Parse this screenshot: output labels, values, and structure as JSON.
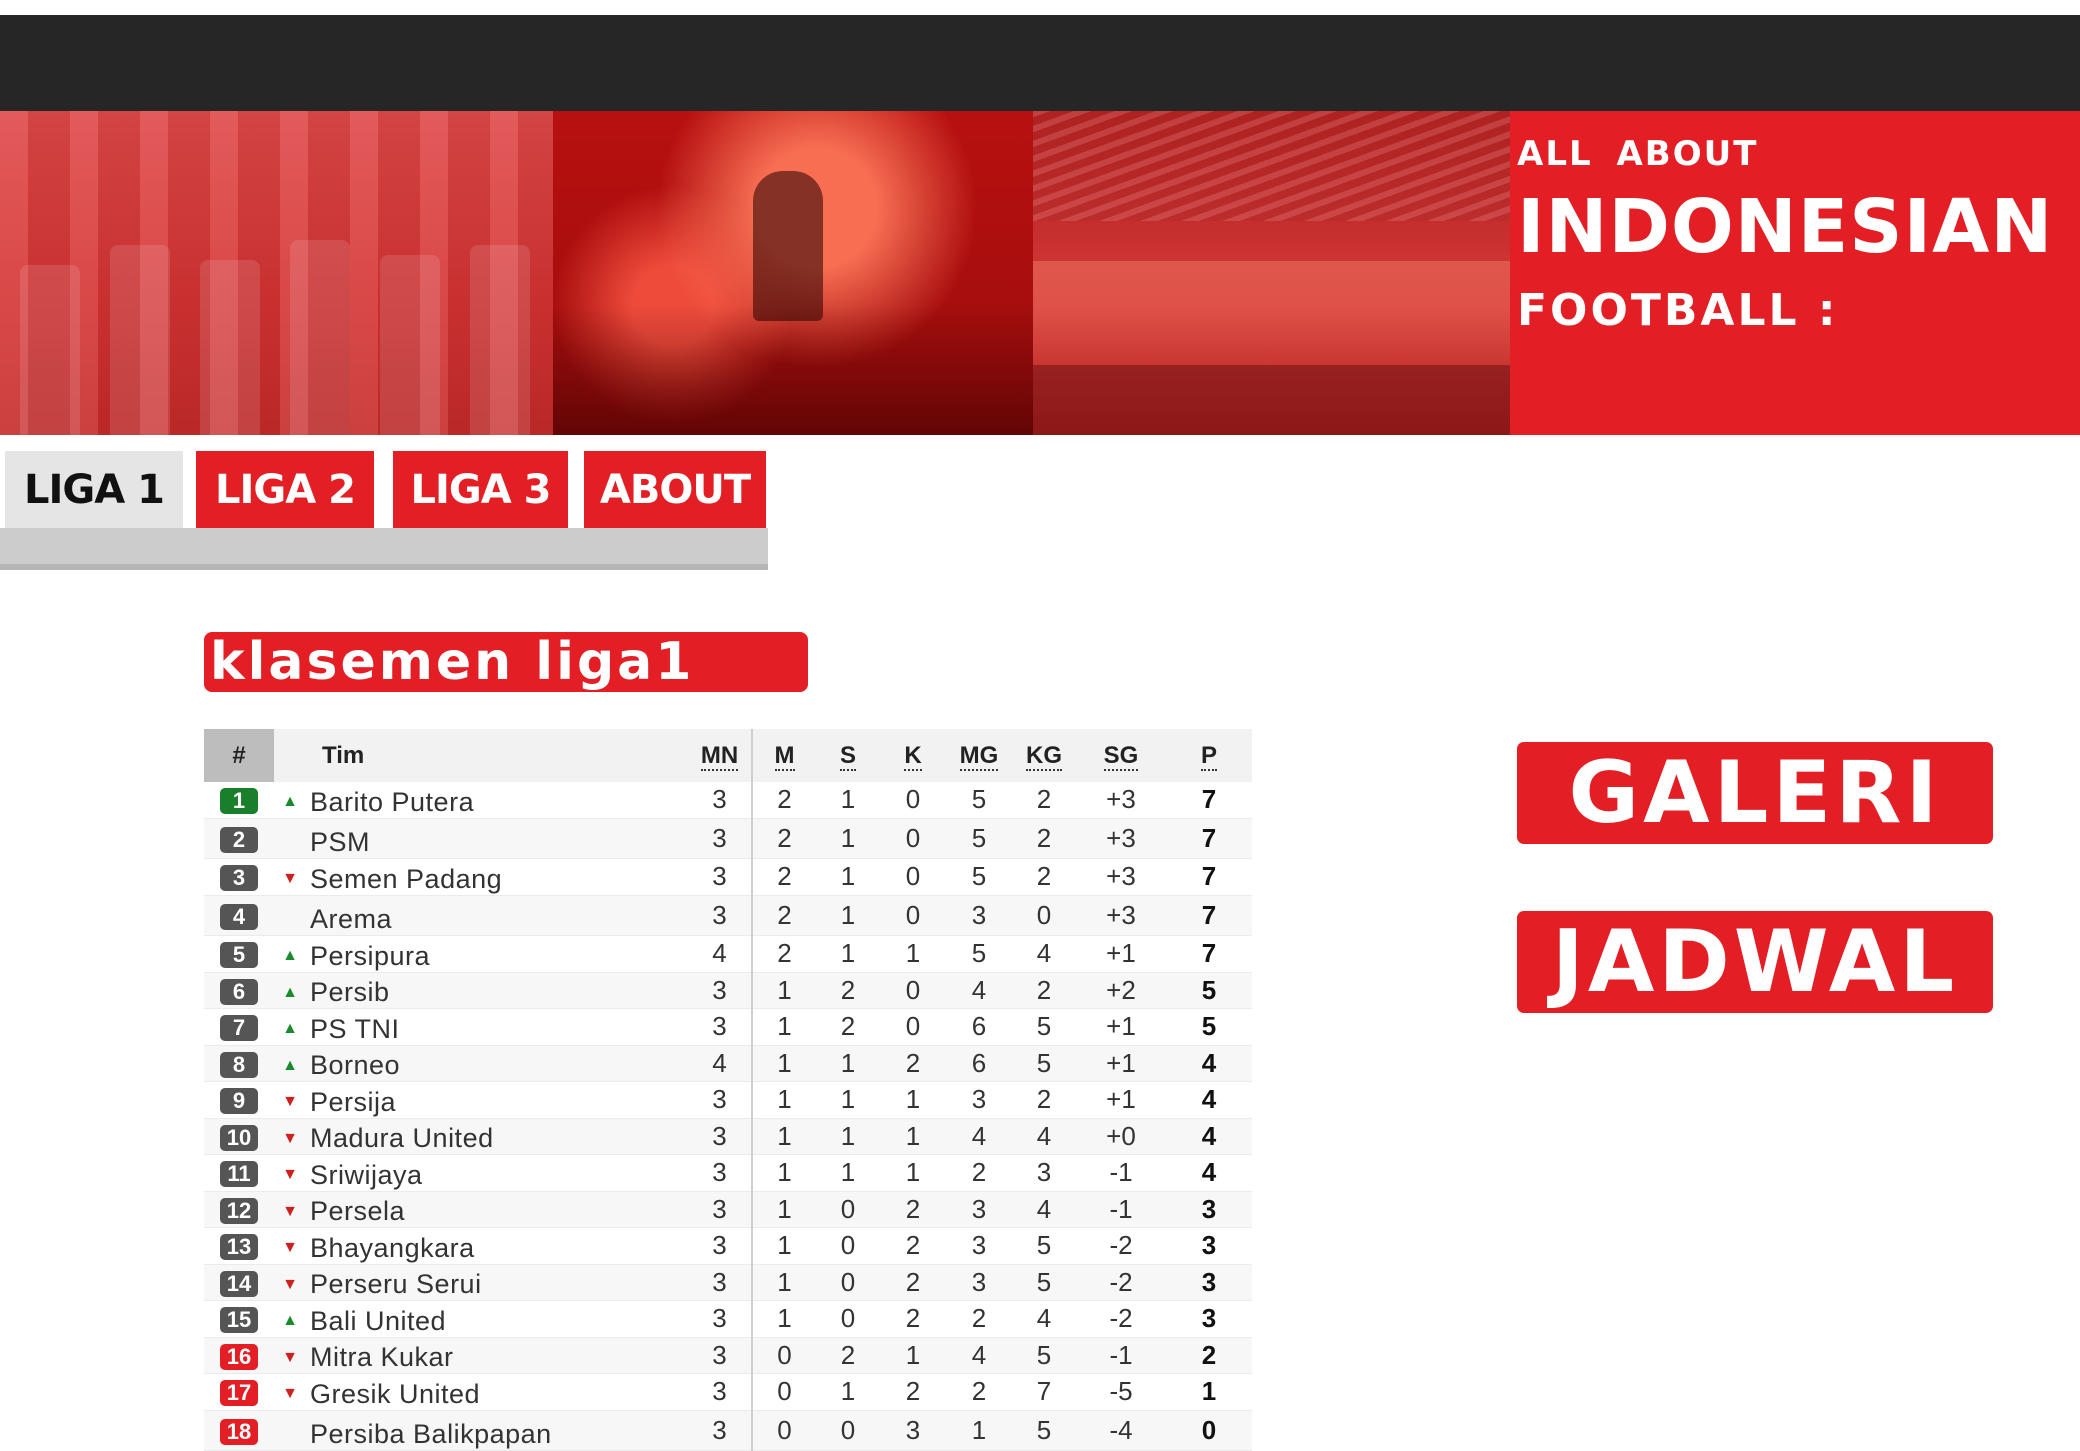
{
  "banner": {
    "line1": "ALL  ABOUT",
    "line2": "INDONESIAN",
    "line3": "FOOTBALL :"
  },
  "nav": {
    "tabs": [
      {
        "label": "LIGA 1",
        "active": true
      },
      {
        "label": "LIGA 2",
        "active": false
      },
      {
        "label": "LIGA 3",
        "active": false
      },
      {
        "label": "ABOUT",
        "active": false
      }
    ]
  },
  "standings": {
    "title": "klasemen liga1",
    "columns": [
      "#",
      "Tim",
      "MN",
      "M",
      "S",
      "K",
      "MG",
      "KG",
      "SG",
      "P"
    ],
    "rows": [
      {
        "rank": "1",
        "zone": "green",
        "trend": "up",
        "team": "Barito Putera",
        "mn": "3",
        "m": "2",
        "s": "1",
        "k": "0",
        "mg": "5",
        "kg": "2",
        "sg": "+3",
        "p": "7"
      },
      {
        "rank": "2",
        "zone": "gray",
        "trend": "none",
        "team": "PSM",
        "mn": "3",
        "m": "2",
        "s": "1",
        "k": "0",
        "mg": "5",
        "kg": "2",
        "sg": "+3",
        "p": "7"
      },
      {
        "rank": "3",
        "zone": "gray",
        "trend": "down",
        "team": "Semen Padang",
        "mn": "3",
        "m": "2",
        "s": "1",
        "k": "0",
        "mg": "5",
        "kg": "2",
        "sg": "+3",
        "p": "7"
      },
      {
        "rank": "4",
        "zone": "gray",
        "trend": "none",
        "team": "Arema",
        "mn": "3",
        "m": "2",
        "s": "1",
        "k": "0",
        "mg": "3",
        "kg": "0",
        "sg": "+3",
        "p": "7"
      },
      {
        "rank": "5",
        "zone": "gray",
        "trend": "up",
        "team": "Persipura",
        "mn": "4",
        "m": "2",
        "s": "1",
        "k": "1",
        "mg": "5",
        "kg": "4",
        "sg": "+1",
        "p": "7"
      },
      {
        "rank": "6",
        "zone": "gray",
        "trend": "up",
        "team": "Persib",
        "mn": "3",
        "m": "1",
        "s": "2",
        "k": "0",
        "mg": "4",
        "kg": "2",
        "sg": "+2",
        "p": "5"
      },
      {
        "rank": "7",
        "zone": "gray",
        "trend": "up",
        "team": "PS TNI",
        "mn": "3",
        "m": "1",
        "s": "2",
        "k": "0",
        "mg": "6",
        "kg": "5",
        "sg": "+1",
        "p": "5"
      },
      {
        "rank": "8",
        "zone": "gray",
        "trend": "up",
        "team": "Borneo",
        "mn": "4",
        "m": "1",
        "s": "1",
        "k": "2",
        "mg": "6",
        "kg": "5",
        "sg": "+1",
        "p": "4"
      },
      {
        "rank": "9",
        "zone": "gray",
        "trend": "down",
        "team": "Persija",
        "mn": "3",
        "m": "1",
        "s": "1",
        "k": "1",
        "mg": "3",
        "kg": "2",
        "sg": "+1",
        "p": "4"
      },
      {
        "rank": "10",
        "zone": "gray",
        "trend": "down",
        "team": "Madura United",
        "mn": "3",
        "m": "1",
        "s": "1",
        "k": "1",
        "mg": "4",
        "kg": "4",
        "sg": "+0",
        "p": "4"
      },
      {
        "rank": "11",
        "zone": "gray",
        "trend": "down",
        "team": "Sriwijaya",
        "mn": "3",
        "m": "1",
        "s": "1",
        "k": "1",
        "mg": "2",
        "kg": "3",
        "sg": "-1",
        "p": "4"
      },
      {
        "rank": "12",
        "zone": "gray",
        "trend": "down",
        "team": "Persela",
        "mn": "3",
        "m": "1",
        "s": "0",
        "k": "2",
        "mg": "3",
        "kg": "4",
        "sg": "-1",
        "p": "3"
      },
      {
        "rank": "13",
        "zone": "gray",
        "trend": "down",
        "team": "Bhayangkara",
        "mn": "3",
        "m": "1",
        "s": "0",
        "k": "2",
        "mg": "3",
        "kg": "5",
        "sg": "-2",
        "p": "3"
      },
      {
        "rank": "14",
        "zone": "gray",
        "trend": "down",
        "team": "Perseru Serui",
        "mn": "3",
        "m": "1",
        "s": "0",
        "k": "2",
        "mg": "3",
        "kg": "5",
        "sg": "-2",
        "p": "3"
      },
      {
        "rank": "15",
        "zone": "gray",
        "trend": "up",
        "team": "Bali United",
        "mn": "3",
        "m": "1",
        "s": "0",
        "k": "2",
        "mg": "2",
        "kg": "4",
        "sg": "-2",
        "p": "3"
      },
      {
        "rank": "16",
        "zone": "red",
        "trend": "down",
        "team": "Mitra Kukar",
        "mn": "3",
        "m": "0",
        "s": "2",
        "k": "1",
        "mg": "4",
        "kg": "5",
        "sg": "-1",
        "p": "2"
      },
      {
        "rank": "17",
        "zone": "red",
        "trend": "down",
        "team": "Gresik United",
        "mn": "3",
        "m": "0",
        "s": "1",
        "k": "2",
        "mg": "2",
        "kg": "7",
        "sg": "-5",
        "p": "1"
      },
      {
        "rank": "18",
        "zone": "red",
        "trend": "none",
        "team": "Persiba Balikpapan",
        "mn": "3",
        "m": "0",
        "s": "0",
        "k": "3",
        "mg": "1",
        "kg": "5",
        "sg": "-4",
        "p": "0"
      }
    ]
  },
  "sidebar": {
    "galeri_label": "GALERI",
    "jadwal_label": "JADWAL"
  },
  "colors": {
    "accent": "#e31e24",
    "topbar": "#262626",
    "zone_green": "#1a7f2a",
    "zone_gray": "#555555",
    "zone_red": "#e31e24",
    "trend_up": "#1b8a2c",
    "trend_down": "#d01f1f"
  },
  "icons": {
    "trend_up": "triangle-up-icon",
    "trend_down": "triangle-down-icon"
  }
}
